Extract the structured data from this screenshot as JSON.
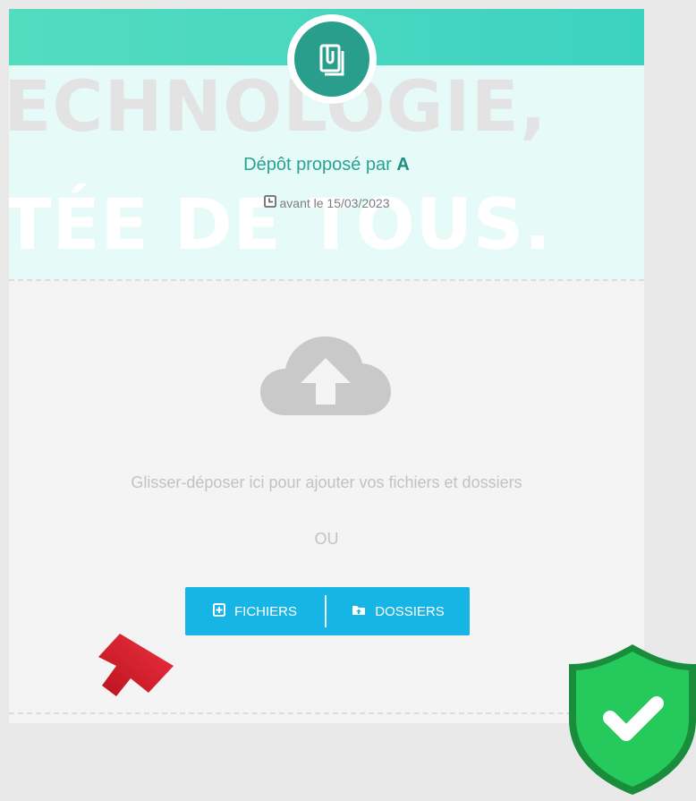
{
  "hero": {
    "line1": "ECHNOLOGIE,",
    "line2": "TÉE DE TOUS."
  },
  "deposit": {
    "title_prefix": "Dépôt proposé par",
    "author": "A",
    "deadline": "avant le 15/03/2023"
  },
  "dropzone": {
    "hint": "Glisser-déposer ici pour ajouter vos fichiers et dossiers",
    "or_label": "OU",
    "files_button": "FICHIERS",
    "folders_button": "DOSSIERS"
  },
  "icons": {
    "logo": "paper-clip-document-icon",
    "clock": "clock-icon",
    "upload": "cloud-upload-icon",
    "file_add": "file-add-icon",
    "folder_upload": "folder-upload-icon",
    "arrow": "red-arrow-icon",
    "shield": "shield-check-icon"
  },
  "colors": {
    "teal_bar": "#3cd2c1",
    "hero_bg": "#e6fbf8",
    "logo": "#2a9e8d",
    "title": "#27a394",
    "button": "#17b4e6",
    "arrow": "#e02233",
    "shield": "#1ec95f"
  }
}
